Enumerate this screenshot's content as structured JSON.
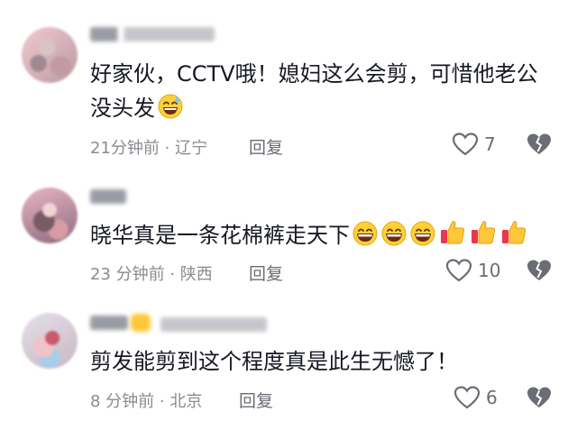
{
  "comments": [
    {
      "text": "好家伙，CCTV哦！媳妇这么会剪，可惜他老公没头发",
      "emojis": [
        "grin-sweat"
      ],
      "time": "21分钟前",
      "location": "辽宁",
      "reply_label": "回复",
      "likes": "7"
    },
    {
      "text": "晓华真是一条花棉裤走天下",
      "emojis": [
        "grin",
        "grin",
        "grin",
        "thumbs-up",
        "thumbs-up",
        "thumbs-up"
      ],
      "time": "23 分钟前",
      "location": "陕西",
      "reply_label": "回复",
      "likes": "10"
    },
    {
      "text": "剪发能剪到这个程度真是此生无憾了！",
      "emojis": [],
      "time": "8 分钟前",
      "location": "北京",
      "reply_label": "回复",
      "likes": "6"
    }
  ]
}
